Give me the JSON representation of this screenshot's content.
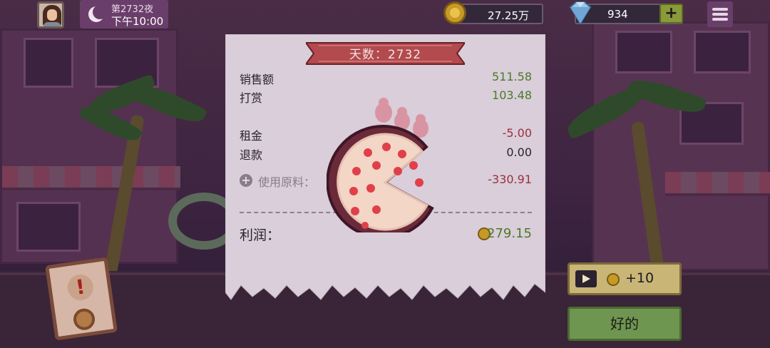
{
  "hud": {
    "avatar_icon": "player-avatar",
    "night_label": "第2732夜",
    "time_label": "下午10:00",
    "coins": "27.25万",
    "gems": "934",
    "plus_label": "+",
    "menu_icon": "hamburger-menu-icon"
  },
  "receipt": {
    "banner": "天数：2732",
    "rows": [
      {
        "label": "销售额",
        "amount": "511.58"
      },
      {
        "label": "打赏",
        "amount": "103.48"
      },
      {
        "label": "租金",
        "amount": "-5.00"
      },
      {
        "label": "退款",
        "amount": "0.00"
      },
      {
        "label": "使用原料：",
        "amount": "-330.91"
      }
    ],
    "profit_label": "利润：",
    "profit_amount": "279.15"
  },
  "buttons": {
    "ad_reward": "+10",
    "ok": "好的"
  },
  "colors": {
    "positive": "#4a7a2a",
    "negative": "#9a3040",
    "banner": "#b24a4e",
    "ok_button": "#6f9650",
    "ad_button": "#c9b576"
  }
}
